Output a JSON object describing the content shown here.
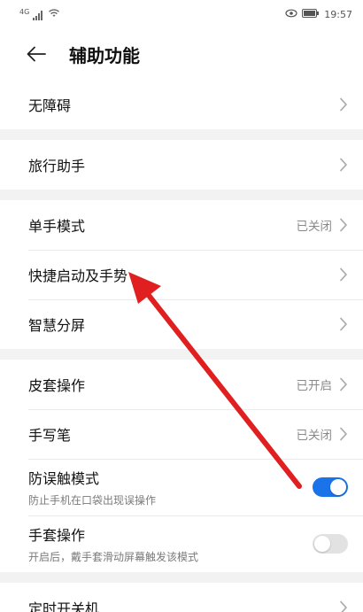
{
  "status_bar": {
    "network_label": "4G",
    "time": "19:57",
    "icons": [
      "signal-icon",
      "wifi-icon",
      "eye-icon",
      "battery-icon"
    ]
  },
  "header": {
    "title": "辅助功能",
    "back_icon": "back-arrow-icon"
  },
  "groups": [
    {
      "items": [
        {
          "label": "无障碍"
        }
      ]
    },
    {
      "items": [
        {
          "label": "旅行助手"
        }
      ]
    },
    {
      "items": [
        {
          "label": "单手模式",
          "value": "已关闭"
        },
        {
          "label": "快捷启动及手势"
        },
        {
          "label": "智慧分屏"
        }
      ]
    },
    {
      "items": [
        {
          "label": "皮套操作",
          "value": "已开启"
        },
        {
          "label": "手写笔",
          "value": "已关闭"
        },
        {
          "label": "防误触模式",
          "subtitle": "防止手机在口袋出现误操作",
          "toggle": true
        },
        {
          "label": "手套操作",
          "subtitle": "开启后，戴手套滑动屏幕触发该模式",
          "toggle": false
        }
      ]
    },
    {
      "items": [
        {
          "label": "定时开关机"
        }
      ]
    }
  ],
  "colors": {
    "accent": "#1a73e8",
    "annotation_arrow": "#e02020",
    "divider": "#ececec",
    "section_gap": "#f2f2f2"
  }
}
